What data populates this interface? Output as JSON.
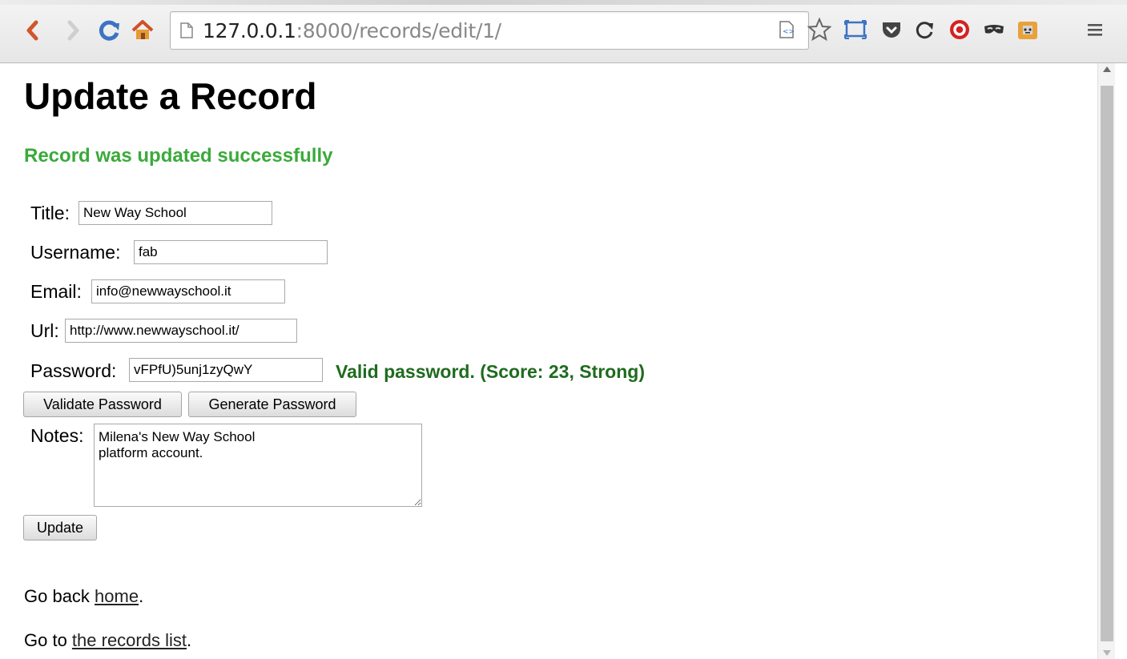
{
  "browser": {
    "url_host": "127.0.0.1",
    "url_rest": ":8000/records/edit/1/"
  },
  "page": {
    "title": "Update a Record",
    "success_message": "Record was updated successfully"
  },
  "form": {
    "title_label": "Title:",
    "title_value": "New Way School",
    "username_label": "Username:",
    "username_value": "fab",
    "email_label": "Email:",
    "email_value": "info@newwayschool.it",
    "url_label": "Url:",
    "url_value": "http://www.newwayschool.it/",
    "password_label": "Password:",
    "password_value": "vFPfU)5unj1zyQwY",
    "password_status": "Valid password. (Score: 23, Strong)",
    "validate_button": "Validate Password",
    "generate_button": "Generate Password",
    "notes_label": "Notes:",
    "notes_value": "Milena's New Way School\nplatform account.",
    "update_button": "Update"
  },
  "footer": {
    "home_prefix": "Go back ",
    "home_link": "home",
    "home_suffix": ".",
    "list_prefix": "Go to ",
    "list_link": "the records list",
    "list_suffix": "."
  },
  "colors": {
    "success": "#3aaa3a",
    "password_status": "#1f6b1f"
  },
  "icons": [
    "back-icon",
    "forward-icon",
    "reload-icon",
    "home-icon",
    "page-icon",
    "reader-icon",
    "bookmark-star-icon",
    "screen-icon",
    "pocket-icon",
    "refresh-extension-icon",
    "stop-extension-icon",
    "mask-extension-icon",
    "puzzle-extension-icon",
    "menu-icon"
  ]
}
